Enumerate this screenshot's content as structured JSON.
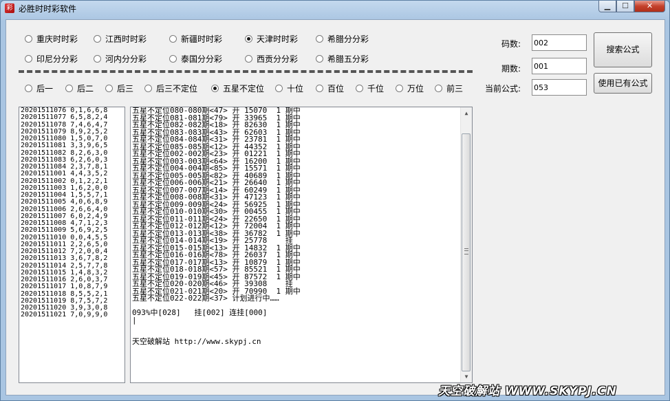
{
  "window": {
    "title": "必胜时时彩软件",
    "icon": "app-icon"
  },
  "lottery_options": [
    {
      "label": "重庆时时彩",
      "checked": false
    },
    {
      "label": "江西时时彩",
      "checked": false
    },
    {
      "label": "新疆时时彩",
      "checked": false
    },
    {
      "label": "天津时时彩",
      "checked": true
    },
    {
      "label": "希腊分分彩",
      "checked": false
    },
    {
      "label": "印尼分分彩",
      "checked": false
    },
    {
      "label": "河内分分彩",
      "checked": false
    },
    {
      "label": "泰国分分彩",
      "checked": false
    },
    {
      "label": "西贡分分彩",
      "checked": false
    },
    {
      "label": "希腊五分彩",
      "checked": false
    }
  ],
  "position_options": [
    {
      "label": "后一",
      "checked": false
    },
    {
      "label": "后二",
      "checked": false
    },
    {
      "label": "后三",
      "checked": false
    },
    {
      "label": "后三不定位",
      "checked": false
    },
    {
      "label": "五星不定位",
      "checked": true
    },
    {
      "label": "十位",
      "checked": false
    },
    {
      "label": "百位",
      "checked": false
    },
    {
      "label": "千位",
      "checked": false
    },
    {
      "label": "万位",
      "checked": false
    },
    {
      "label": "前三",
      "checked": false
    }
  ],
  "form": {
    "code_count_label": "码数:",
    "code_count_value": "002",
    "period_count_label": "期数:",
    "period_count_value": "001",
    "current_formula_label": "当前公式:",
    "current_formula_value": "053"
  },
  "buttons": {
    "search_formula": "搜索公式",
    "use_existing_formula": "使用已有公式"
  },
  "history": [
    "20201511076 0,1,6,6,8",
    "20201511077 6,5,8,2,4",
    "20201511078 7,4,6,4,7",
    "20201511079 8,9,2,5,2",
    "20201511080 1,5,0,7,0",
    "20201511081 3,3,9,6,5",
    "20201511082 8,2,6,3,0",
    "20201511083 6,2,6,0,3",
    "20201511084 2,3,7,8,1",
    "20201511001 4,4,3,5,2",
    "20201511002 0,1,2,2,1",
    "20201511003 1,6,2,0,0",
    "20201511004 1,5,5,7,1",
    "20201511005 4,0,6,8,9",
    "20201511006 2,6,6,4,0",
    "20201511007 6,0,2,4,9",
    "20201511008 4,7,1,2,3",
    "20201511009 5,6,9,2,5",
    "20201511010 0,0,4,5,5",
    "20201511011 2,2,6,5,0",
    "20201511012 7,2,0,0,4",
    "20201511013 3,6,7,8,2",
    "20201511014 2,5,7,7,8",
    "20201511015 1,4,8,3,2",
    "20201511016 2,6,0,3,7",
    "20201511017 1,0,8,7,9",
    "20201511018 8,5,5,2,1",
    "20201511019 8,7,5,7,2",
    "20201511020 3,9,3,0,8",
    "20201511021 7,0,9,9,0"
  ],
  "results": [
    "五星不定位080-080期<47> 开 15070  1 期中",
    "五星不定位081-081期<79> 开 33965  1 期中",
    "五星不定位082-082期<18> 开 82630  1 期中",
    "五星不定位083-083期<43> 开 62603  1 期中",
    "五星不定位084-084期<31> 开 23781  1 期中",
    "五星不定位085-085期<12> 开 44352  1 期中",
    "五星不定位002-002期<23> 开 01221  1 期中",
    "五星不定位003-003期<64> 开 16200  1 期中",
    "五星不定位004-004期<85> 开 15571  1 期中",
    "五星不定位005-005期<82> 开 40689  1 期中",
    "五星不定位006-006期<21> 开 26640  1 期中",
    "五星不定位007-007期<14> 开 60249  1 期中",
    "五星不定位008-008期<31> 开 47123  1 期中",
    "五星不定位009-009期<24> 开 56925  1 期中",
    "五星不定位010-010期<30> 开 00455  1 期中",
    "五星不定位011-011期<24> 开 22650  1 期中",
    "五星不定位012-012期<12> 开 72004  1 期中",
    "五星不定位013-013期<38> 开 36782  1 期中",
    "五星不定位014-014期<19> 开 25778    挂",
    "五星不定位015-015期<13> 开 14832  1 期中",
    "五星不定位016-016期<78> 开 26037  1 期中",
    "五星不定位017-017期<13> 开 10879  1 期中",
    "五星不定位018-018期<57> 开 85521  1 期中",
    "五星不定位019-019期<45> 开 87572  1 期中",
    "五星不定位020-020期<46> 开 39308    挂",
    "五星不定位021-021期<20> 开 70990  1 期中",
    "五星不定位022-022期<37> 计划进行中……",
    "",
    "093%中[028]   挂[002] 连挂[000]",
    "|",
    "",
    "",
    "天空破解站 http://www.skypj.cn"
  ],
  "watermark": "天空破解站 WWW.SKYPJ.CN"
}
